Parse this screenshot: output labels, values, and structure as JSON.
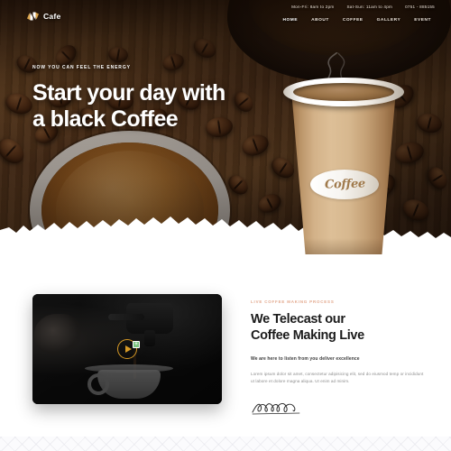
{
  "brand": {
    "name": "Cafe",
    "logo_icon": "cafe-wings-mark-icon"
  },
  "topbar": {
    "hours_weekday": "Mon-Fri: 8am to 2pm",
    "hours_weekend": "Sat-Sun: 11am to 4pm",
    "phone": "0751 - 885155"
  },
  "nav": {
    "items": [
      {
        "label": "HOME",
        "active": true
      },
      {
        "label": "ABOUT",
        "active": false
      },
      {
        "label": "COFFEE",
        "active": false
      },
      {
        "label": "GALLERY",
        "active": false
      },
      {
        "label": "EVENT",
        "active": false
      }
    ]
  },
  "hero": {
    "eyebrow": "NOW YOU CAN FEEL THE ENERGY",
    "title_line1": "Start your day with",
    "title_line2": "a black Coffee",
    "cup_label": "Coffee"
  },
  "telecast": {
    "kicker": "LIVE COFFEE MAKING PROCESS",
    "title_line1": "We Telecast our",
    "title_line2": "Coffee Making Live",
    "subtitle": "We are here to listen from you deliver excellence",
    "body": "Lorem ipsum dolor sit amet, consectetur adipisicing elit, sed do eiusmod temp or incididunt ut labore et dolore magna aliqua. Ut enim ad minim.",
    "signature_alt": "handwritten-signature"
  },
  "video": {
    "play_icon": "play-circle-icon",
    "cursor_icon": "green-cursor-badge-icon",
    "scene": "barista-pouring-espresso"
  },
  "colors": {
    "accent_gold": "#d79a26",
    "kicker_salmon": "#e3a98e",
    "cup_tan": "#d3b289",
    "label_brown": "#a07a4c",
    "text_dark": "#1b1b1b",
    "text_muted": "#8d8d8d"
  }
}
